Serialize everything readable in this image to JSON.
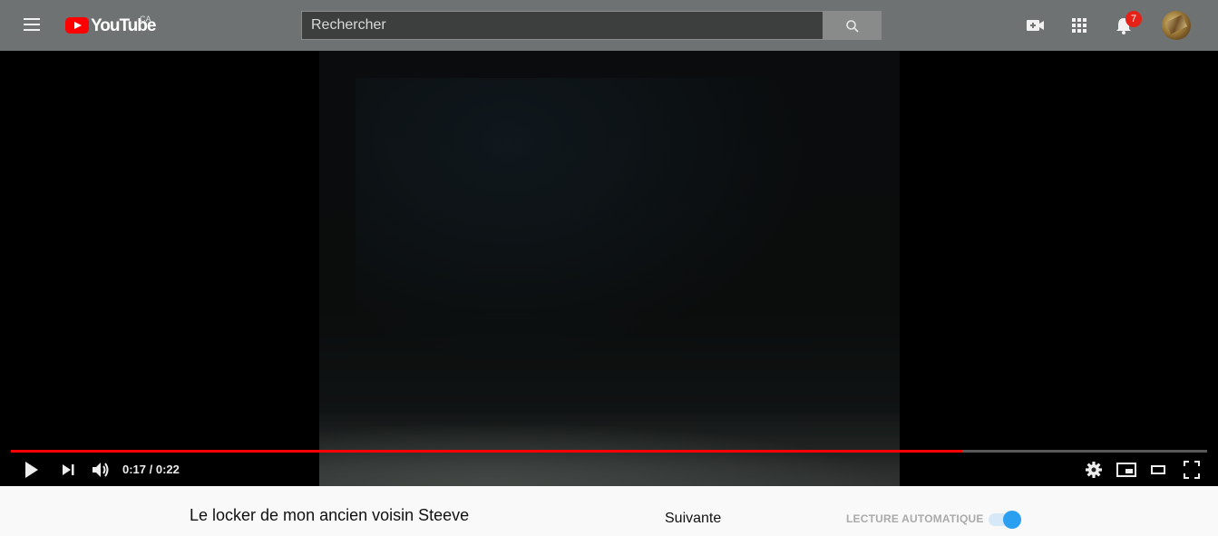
{
  "masthead": {
    "logo_text": "YouTube",
    "country_code": "CA",
    "search_placeholder": "Rechercher",
    "notification_count": "7",
    "icons": [
      "menu-icon",
      "search-icon",
      "video-camera-plus-icon",
      "apps-grid-icon",
      "bell-icon"
    ]
  },
  "player": {
    "time_display": "0:17 / 0:22",
    "progress": 0.795,
    "progress_color": "#ff0000",
    "icons": [
      "play-icon",
      "next-icon",
      "volume-icon",
      "settings-gear-icon",
      "miniplayer-icon",
      "theater-mode-icon",
      "fullscreen-icon"
    ]
  },
  "video": {
    "title": "Le locker de mon ancien voisin Steeve"
  },
  "sidebar": {
    "up_next_label": "Suivante",
    "autoplay_label": "LECTURE AUTOMATIQUE",
    "autoplay_enabled": true,
    "accent_color": "#2b9ff0"
  }
}
